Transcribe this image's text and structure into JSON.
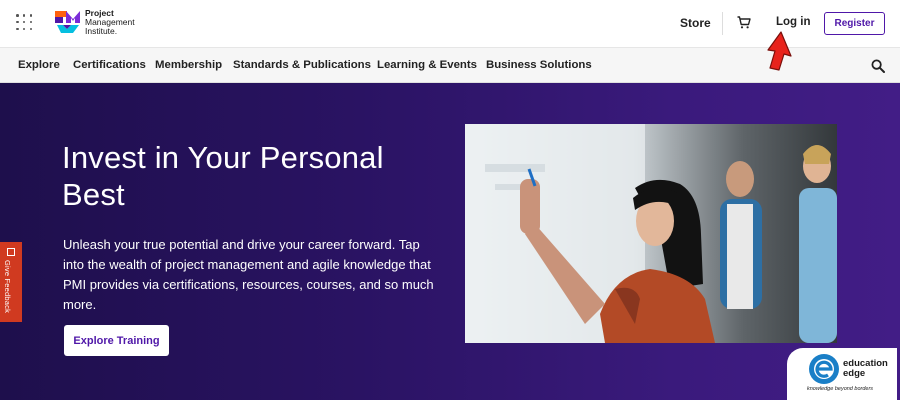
{
  "header": {
    "logo": {
      "line1": "Project",
      "line2": "Management",
      "line3": "Institute."
    },
    "store_label": "Store",
    "login_label": "Log in",
    "register_label": "Register"
  },
  "nav": {
    "items": [
      {
        "label": "Explore"
      },
      {
        "label": "Certifications"
      },
      {
        "label": "Membership"
      },
      {
        "label": "Standards & Publications"
      },
      {
        "label": "Learning & Events"
      },
      {
        "label": "Business Solutions"
      }
    ]
  },
  "hero": {
    "title": "Invest in Your Personal Best",
    "body": "Unleash your true potential and drive your career forward. Tap into the wealth of project management and agile knowledge that PMI provides via certifications, resources, courses, and so much more.",
    "cta_label": "Explore Training"
  },
  "feedback": {
    "label": "Give Feedback"
  },
  "watermark": {
    "line1": "education",
    "line2": "edge",
    "tagline": "knowledge beyond borders"
  },
  "colors": {
    "brand_purple": "#4f17a8",
    "hero_dark": "#1e0f4c",
    "feedback_red": "#d03a20",
    "cursor_red": "#e8231c"
  },
  "icons": [
    "apps-grid-icon",
    "pmi-logo-icon",
    "cart-icon",
    "search-icon",
    "feedback-icon",
    "pointer-cursor-icon"
  ]
}
